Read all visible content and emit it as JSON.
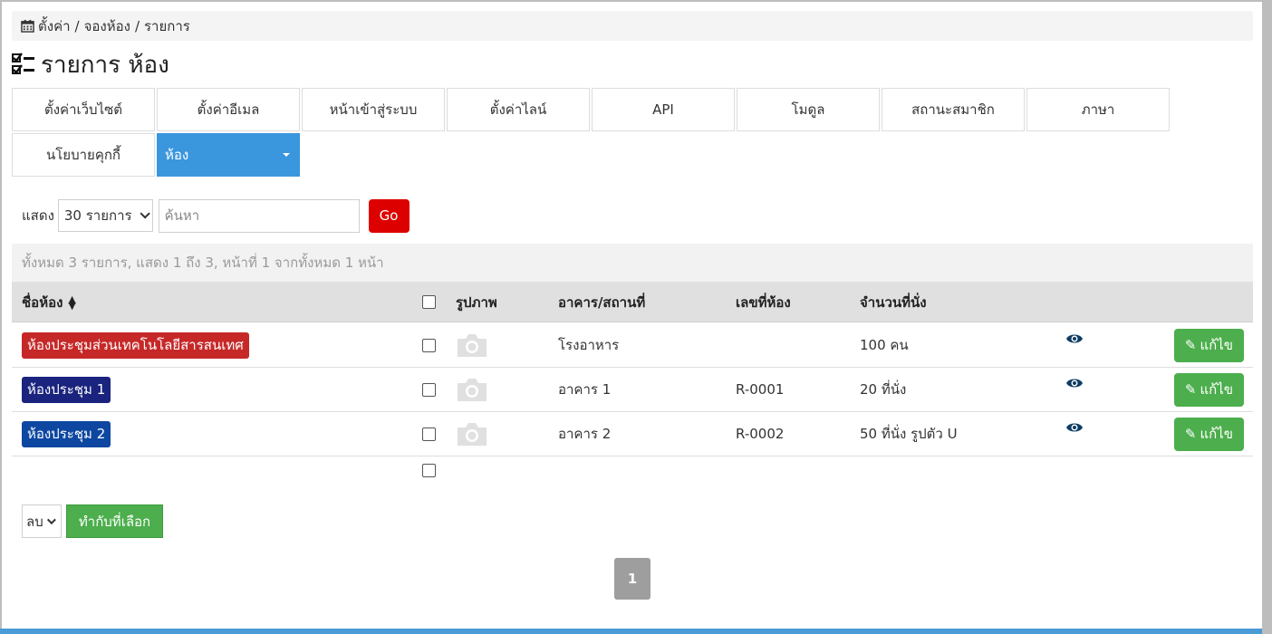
{
  "breadcrumb": {
    "items": [
      "ตั้งค่า",
      "จองห้อง",
      "รายการ"
    ],
    "separator": "/"
  },
  "page_title": "รายการ ห้อง",
  "tabs": [
    {
      "label": "ตั้งค่าเว็บไซต์"
    },
    {
      "label": "ตั้งค่าอีเมล"
    },
    {
      "label": "หน้าเข้าสู่ระบบ"
    },
    {
      "label": "ตั้งค่าไลน์"
    },
    {
      "label": "API"
    },
    {
      "label": "โมดูล"
    },
    {
      "label": "สถานะสมาชิก"
    },
    {
      "label": "ภาษา"
    },
    {
      "label": "นโยบายคุกกี้"
    },
    {
      "label": "ห้อง",
      "active": true
    }
  ],
  "filter": {
    "show_label": "แสดง",
    "per_page_value": "30 รายการ",
    "search_placeholder": "ค้นหา",
    "go_label": "Go"
  },
  "summary": "ทั้งหมด 3 รายการ, แสดง 1 ถึง 3, หน้าที่ 1 จากทั้งหมด 1 หน้า",
  "table": {
    "headers": {
      "name": "ชื่อห้อง",
      "image": "รูปภาพ",
      "building": "อาคาร/สถานที่",
      "room_no": "เลขที่ห้อง",
      "seats": "จำนวนที่นั่ง"
    },
    "rows": [
      {
        "name": "ห้องประชุมส่วนเทคโนโลยีสารสนเทศ",
        "badge_color": "#c62828",
        "building": "โรงอาหาร",
        "room_no": "",
        "seats": "100 คน",
        "edit_label": "แก้ไข"
      },
      {
        "name": "ห้องประชุม 1",
        "badge_color": "#1a237e",
        "building": "อาคาร 1",
        "room_no": "R-0001",
        "seats": "20 ที่นั่ง",
        "edit_label": "แก้ไข"
      },
      {
        "name": "ห้องประชุม 2",
        "badge_color": "#0d47a1",
        "building": "อาคาร 2",
        "room_no": "R-0002",
        "seats": "50 ที่นั่ง รูปตัว U",
        "edit_label": "แก้ไข"
      }
    ]
  },
  "bulk": {
    "action_value": "ลบ",
    "apply_label": "ทำกับที่เลือก"
  },
  "pagination": {
    "current_page": "1"
  },
  "colors": {
    "accent_tab": "#3a96dd",
    "go_button": "#dd0000",
    "edit_button": "#4cae4c"
  }
}
